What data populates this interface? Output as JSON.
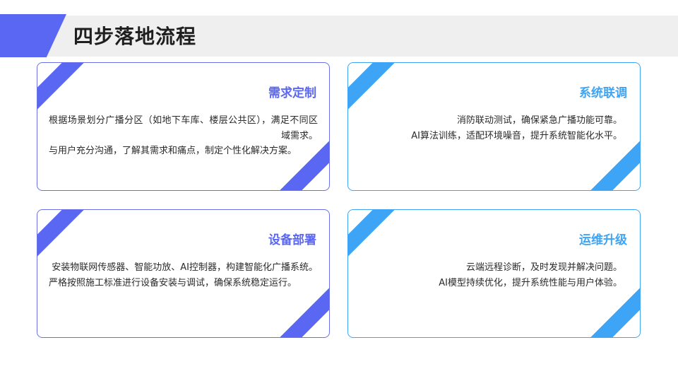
{
  "header": {
    "title": "四步落地流程"
  },
  "cards": [
    {
      "title": "需求定制",
      "lines": [
        "根据场景划分广播分区（如地下车库、楼层公共区），满足不同区域需求。",
        "与用户充分沟通，了解其需求和痛点，制定个性化解决方案。"
      ]
    },
    {
      "title": "系统联调",
      "lines": [
        "消防联动测试，确保紧急广播功能可靠。",
        "AI算法训练，适配环境噪音，提升系统智能化水平。"
      ]
    },
    {
      "title": "设备部署",
      "lines": [
        "安装物联网传感器、智能功放、AI控制器，构建智能化广播系统。",
        "严格按照施工标准进行设备安装与调试，确保系统稳定运行。"
      ]
    },
    {
      "title": "运维升级",
      "lines": [
        "云端远程诊断，及时发现并解决问题。",
        "AI模型持续优化，提升系统性能与用户体验。"
      ]
    }
  ],
  "colors": {
    "purple": "#5a67f2",
    "blue": "#3ea4f5"
  }
}
